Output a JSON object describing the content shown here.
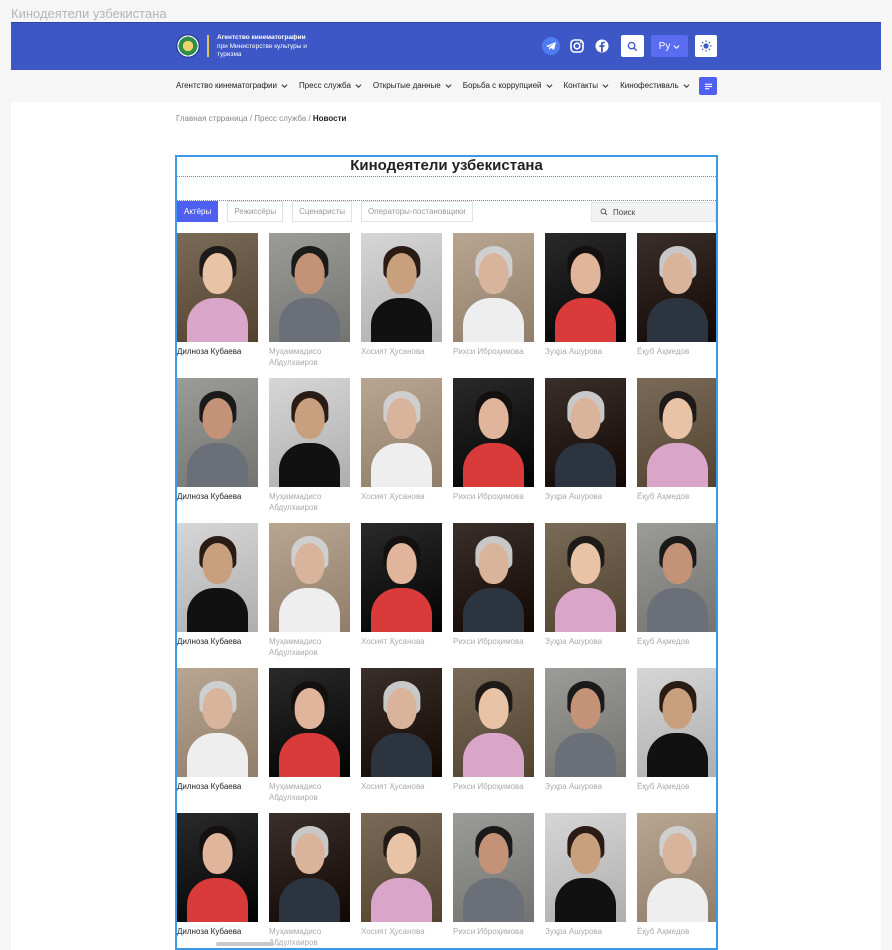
{
  "window_title": "Кинодеятели узбекистана",
  "header": {
    "org_line1": "Агентство кинематографии",
    "org_line2": "при Министерстве культуры и",
    "org_line3": "туризма",
    "icons": [
      "telegram-icon",
      "instagram-icon",
      "facebook-icon"
    ],
    "lang_label": "Ру",
    "accent_color": "#3d57c6"
  },
  "nav": {
    "items": [
      {
        "label": "Агентство кинематографии"
      },
      {
        "label": "Пресс служба"
      },
      {
        "label": "Открытые данные"
      },
      {
        "label": "Борьба с коррупцией"
      },
      {
        "label": "Контакты"
      },
      {
        "label": "Кинофестиваль"
      }
    ]
  },
  "breadcrumb": {
    "home": "Главная стрраница",
    "sep1": " / ",
    "section": "Пресс служба",
    "sep2": " / ",
    "current": "Новости"
  },
  "page_title": "Кинодеятели узбекистана",
  "tabs": [
    {
      "label": "Актёры",
      "active": true
    },
    {
      "label": "Режиссёры",
      "active": false
    },
    {
      "label": "Сценаристы",
      "active": false
    },
    {
      "label": "Операторы-постановщики",
      "active": false
    }
  ],
  "search": {
    "placeholder": "Поиск"
  },
  "people_rows": [
    [
      "Дилноза Кубаева",
      "Муҳаммадисо Абдулхаиров",
      "Хосият Ҳусанова",
      "Рихси Иброҳимова",
      "Зуҳра Ашурова",
      "Ёқуб Аҳмедов"
    ],
    [
      "Дилноза Кубаева",
      "Муҳаммадисо Абдулхаиров",
      "Хосият Ҳусанова",
      "Рихси Иброҳимова",
      "Зуҳра Ашурова",
      "Ёқуб Аҳмедов"
    ],
    [
      "Дилноза Кубаева",
      "Муҳаммадисо Абдулхаиров",
      "Хосият Ҳусанова",
      "Рихси Иброҳимова",
      "Зуҳра Ашурова",
      "Ёқуб Аҳмедов"
    ],
    [
      "Дилноза Кубаева",
      "Муҳаммадисо Абдулхаиров",
      "Хосият Ҳусанова",
      "Рихси Иброҳимова",
      "Зуҳра Ашурова",
      "Ёқуб Аҳмедов"
    ],
    [
      "Дилноза Кубаева",
      "Муҳаммадисо Абдулхаиров",
      "Хосият Ҳусанова",
      "Рихси Иброҳимова",
      "Зуҳра Ашурова",
      "Ёқуб Аҳмедов"
    ]
  ]
}
